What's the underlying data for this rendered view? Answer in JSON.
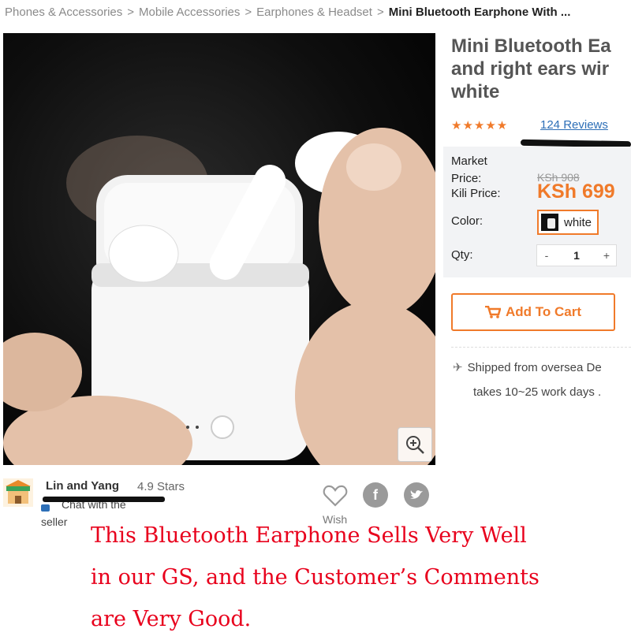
{
  "breadcrumb": {
    "items": [
      "Phones & Accessories",
      "Mobile Accessories",
      "Earphones & Headset"
    ],
    "separator": ">",
    "current": "Mini Bluetooth Earphone With ..."
  },
  "product": {
    "title_lines": [
      "Mini Bluetooth Ea",
      "and right ears wir",
      "white"
    ],
    "rating_stars": "★★★★★",
    "reviews_link": "124 Reviews",
    "market_price_label_line1": "Market",
    "market_price_label_line2": "Price:",
    "market_price": "KSh 908",
    "kili_price_label": "Kili Price:",
    "kili_price": "KSh 699",
    "color_label": "Color:",
    "color_value": "white",
    "qty_label": "Qty:",
    "qty_minus": "-",
    "qty_value": "1",
    "qty_plus": "+",
    "add_to_cart": "Add To Cart",
    "shipping_line1": "Shipped from oversea  De",
    "shipping_line2": "takes 10~25 work days ."
  },
  "seller": {
    "name": "Lin and Yang",
    "rating": "4.9 Stars",
    "chat_line1": "Chat with the",
    "chat_line2": "seller"
  },
  "actions": {
    "wish_label": "Wish"
  },
  "caption": {
    "lines": [
      "This Bluetooth Earphone Sells Very Well",
      "in our GS, and the Customer’s Comments",
      "are Very Good."
    ]
  },
  "colors": {
    "accent": "#f07a2a",
    "link": "#2d6fb7",
    "caption": "#e8001c",
    "price_box_bg": "#f2f3f5"
  },
  "icons": [
    "zoom-icon",
    "shipping-plane-icon",
    "cart-icon",
    "heart-icon",
    "facebook-icon",
    "twitter-icon",
    "chat-icon",
    "store-avatar-icon"
  ]
}
